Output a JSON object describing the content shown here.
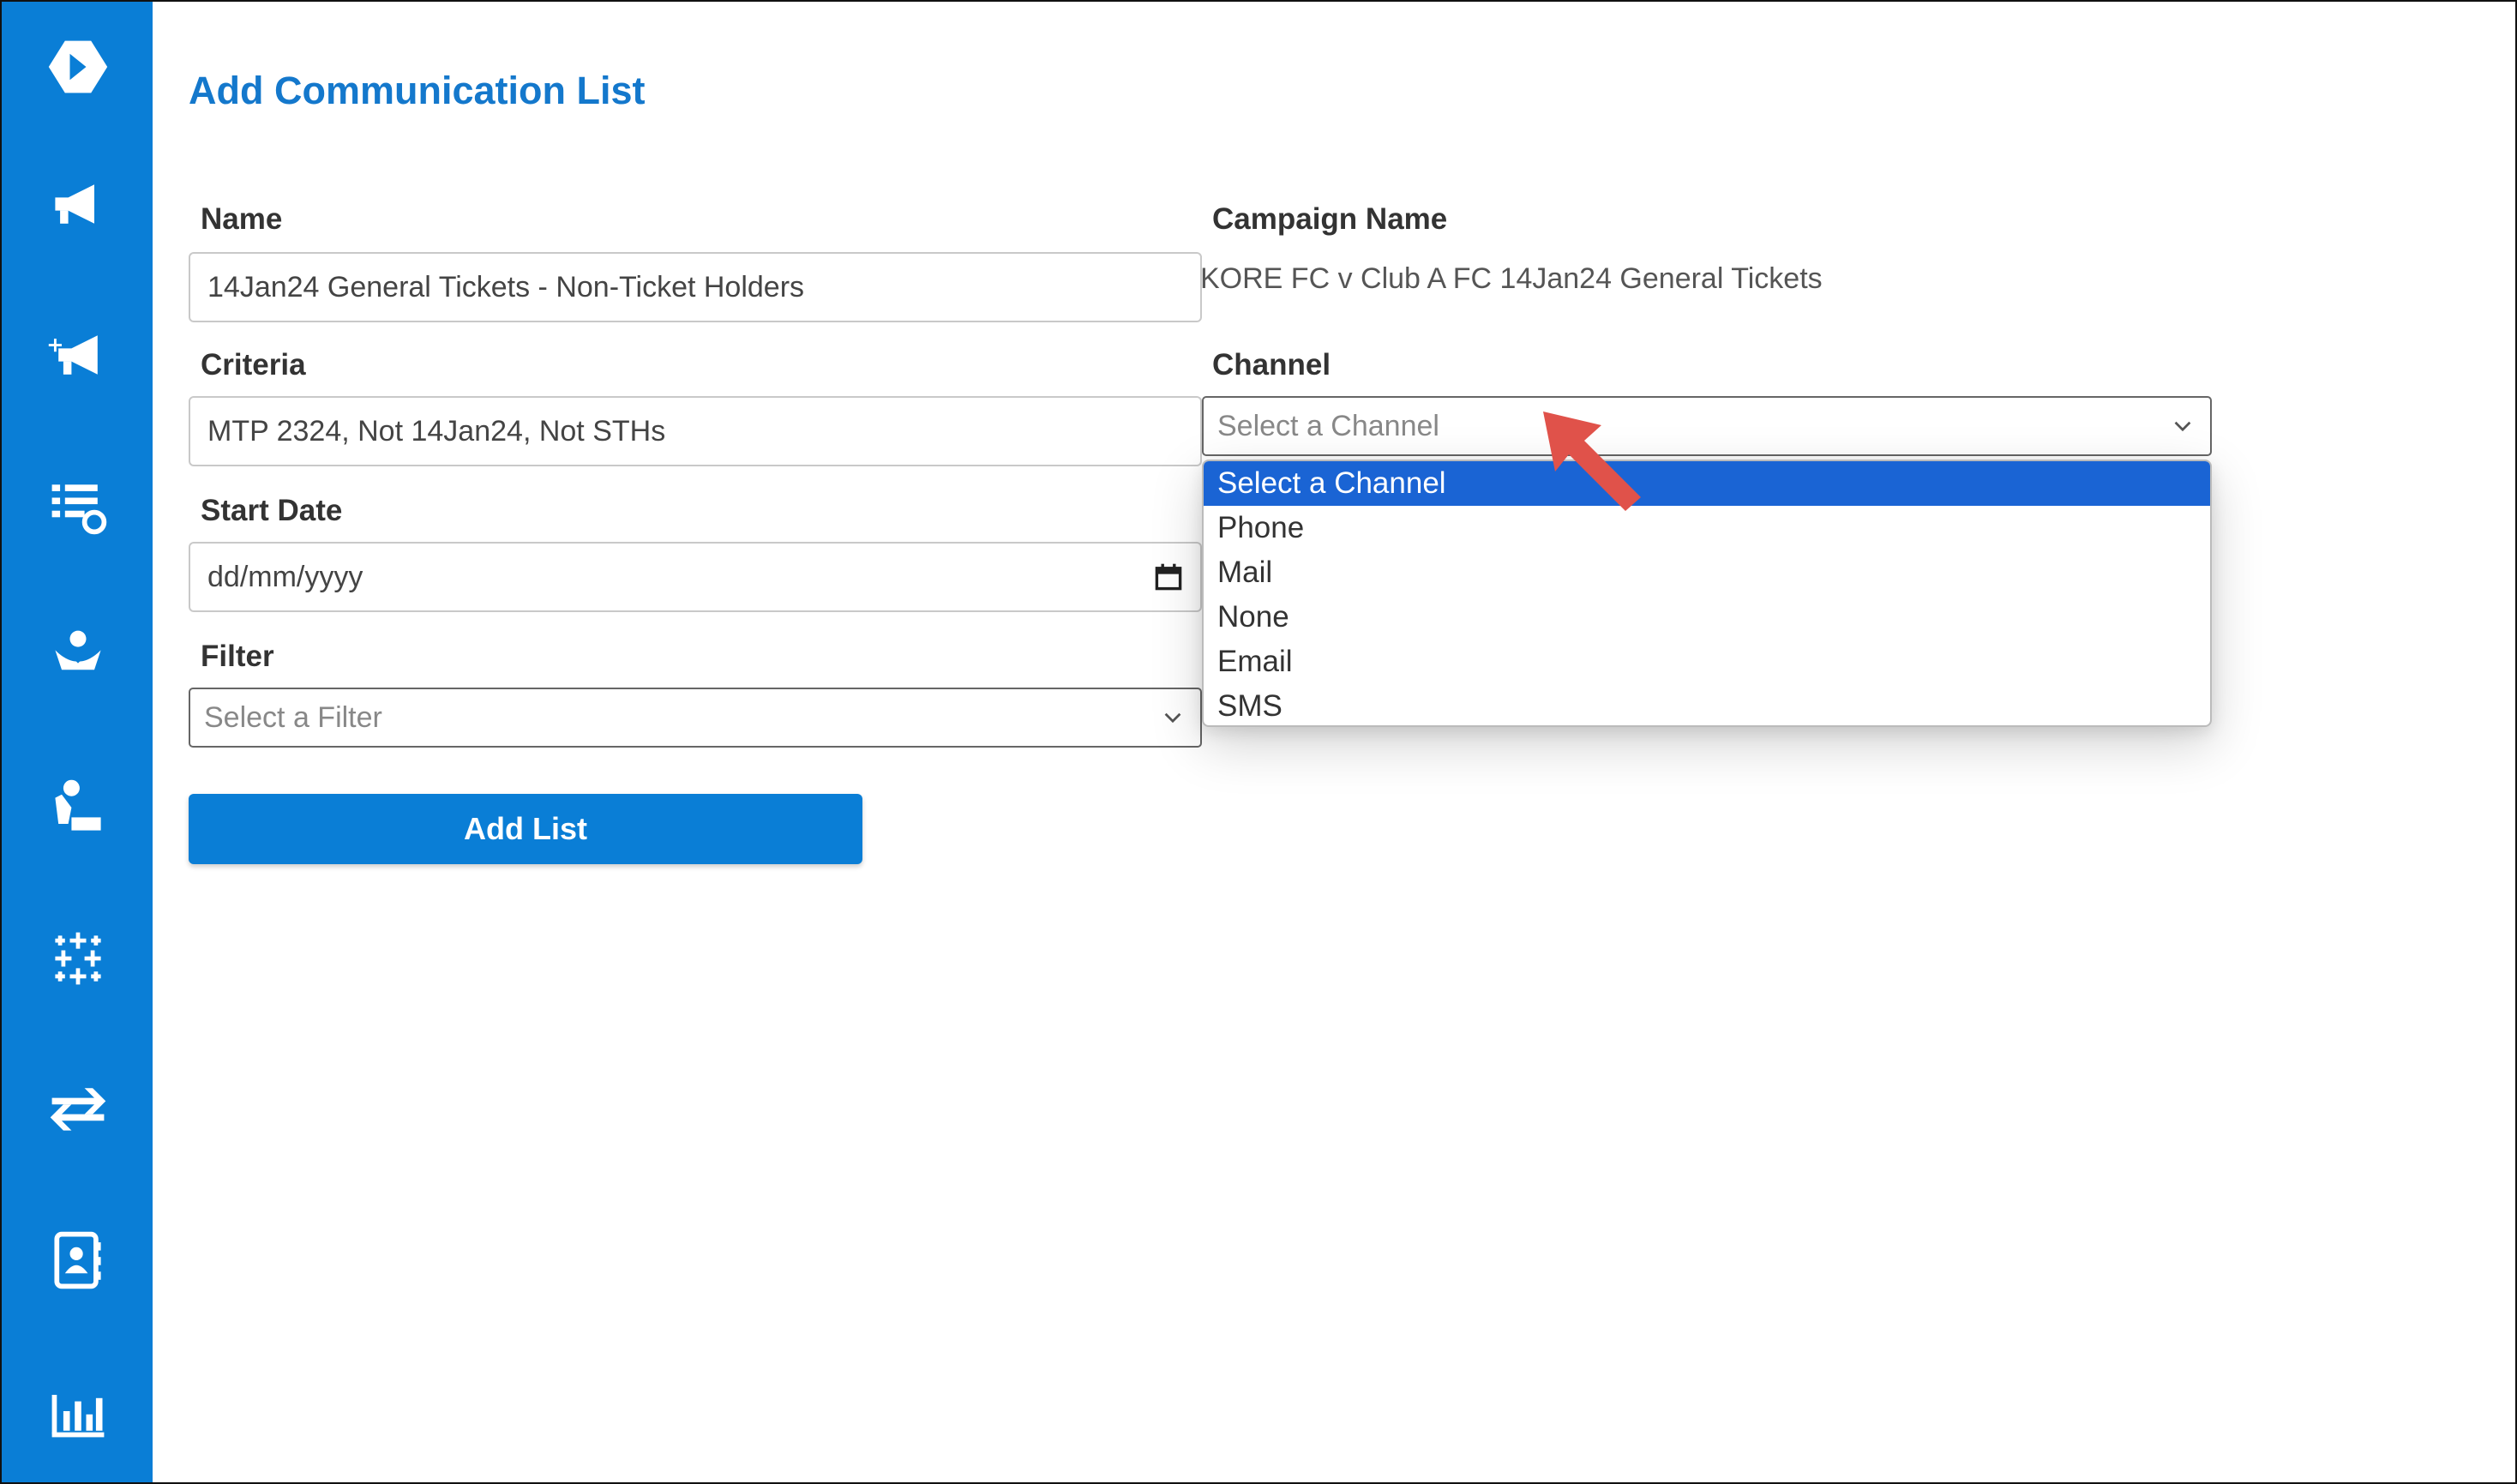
{
  "page": {
    "title": "Add Communication List"
  },
  "sidebar": {
    "items": [
      {
        "icon": "logo-icon"
      },
      {
        "icon": "megaphone-icon"
      },
      {
        "icon": "megaphone-add-icon"
      },
      {
        "icon": "list-settings-icon"
      },
      {
        "icon": "hand-heart-icon"
      },
      {
        "icon": "person-desk-icon"
      },
      {
        "icon": "snowflake-grid-icon"
      },
      {
        "icon": "transfer-arrows-icon"
      },
      {
        "icon": "contact-book-icon"
      },
      {
        "icon": "bar-chart-icon"
      }
    ],
    "color": "#0a7ed6"
  },
  "form": {
    "name_label": "Name",
    "name_value": "14Jan24 General Tickets - Non-Ticket Holders",
    "criteria_label": "Criteria",
    "criteria_value": "MTP 2324, Not 14Jan24, Not STHs",
    "start_date_label": "Start Date",
    "start_date_placeholder": "dd/mm/yyyy",
    "filter_label": "Filter",
    "filter_placeholder": "Select a Filter",
    "campaign_label": "Campaign Name",
    "campaign_value": "KORE FC v Club A FC 14Jan24 General Tickets",
    "channel_label": "Channel",
    "channel_placeholder": "Select a Channel",
    "channel_options": [
      "Select a Channel",
      "Phone",
      "Mail",
      "None",
      "Email",
      "SMS"
    ],
    "submit_label": "Add List"
  },
  "colors": {
    "accent": "#0a7ed6",
    "highlight": "#1a64d4",
    "annotation_arrow": "#e0524a"
  }
}
